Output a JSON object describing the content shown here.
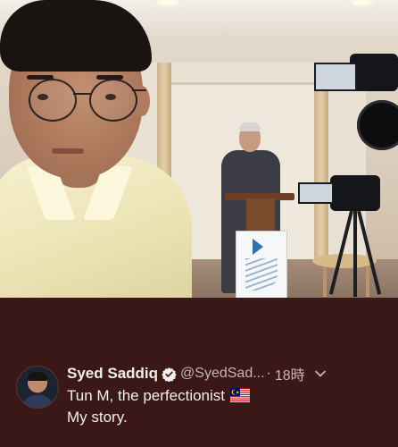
{
  "tweet": {
    "display_name": "Syed Saddiq",
    "handle": "@SyedSad...",
    "separator": "·",
    "time": "18時",
    "text_line1": "Tun M, the perfectionist",
    "text_line2": "My story.",
    "icons": {
      "verified": "verified-badge-icon",
      "more": "chevron-down-icon",
      "flag": "malaysia-flag-icon"
    }
  },
  "colors": {
    "background": "#3a1818",
    "text_primary": "#f4eeee",
    "text_secondary": "#c7b4b4"
  }
}
